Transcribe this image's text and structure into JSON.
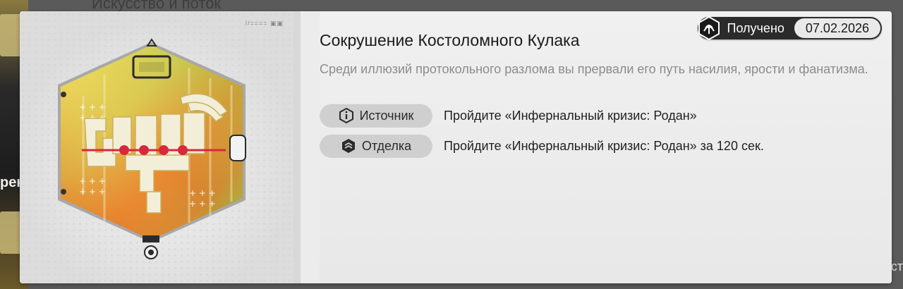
{
  "background": {
    "top_title_fragment": "Искусство и поток",
    "left_fragment": "рек",
    "right_fragment": "ст"
  },
  "card": {
    "art_tag": "//====  ▣▣",
    "status": {
      "label": "Получено",
      "date": "07.02.2026",
      "icon": "medal-badge-icon"
    },
    "title": "Сокрушение Костоломного Кулака",
    "description": "Среди иллюзий протокольного разлома вы прервали его путь насилия, ярости и фанатизма.",
    "requirements": [
      {
        "chip_label": "Источник",
        "icon": "info-icon",
        "text": "Пройдите «Инфернальный кризис: Родан»"
      },
      {
        "chip_label": "Отделка",
        "icon": "layers-icon",
        "text": "Пройдите «Инфернальный кризис: Родан» за 120 сек."
      }
    ]
  },
  "colors": {
    "pill_dark": "#2b2b2b",
    "chip_bg": "#cfcfcf",
    "medal_gold": "#d8c24a",
    "medal_orange": "#e8701e",
    "medal_green": "#6cc23a",
    "accent_red": "#d8283c"
  }
}
